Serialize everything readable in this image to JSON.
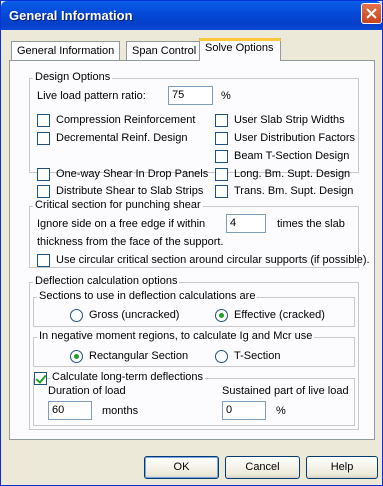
{
  "window": {
    "title": "General Information"
  },
  "tabs": [
    {
      "label": "General Information"
    },
    {
      "label": "Span Control"
    },
    {
      "label": "Solve Options"
    }
  ],
  "design_options": {
    "legend": "Design Options",
    "live_load_label": "Live load pattern ratio:",
    "live_load_value": "75",
    "live_load_unit": "%",
    "checkboxes": {
      "compression": {
        "label": "Compression Reinforcement",
        "checked": false
      },
      "decremental": {
        "label": "Decremental Reinf. Design",
        "checked": false
      },
      "user_slab_strip": {
        "label": "User Slab Strip Widths",
        "checked": false
      },
      "user_distribution": {
        "label": "User Distribution Factors",
        "checked": false
      },
      "beam_tsection": {
        "label": "Beam T-Section Design",
        "checked": false
      },
      "oneway_shear": {
        "label": "One-way Shear In Drop Panels",
        "checked": false
      },
      "distribute_shear": {
        "label": "Distribute Shear to Slab Strips",
        "checked": false
      },
      "long_bm": {
        "label": "Long. Bm. Supt. Design",
        "checked": false
      },
      "trans_bm": {
        "label": "Trans. Bm. Supt. Design",
        "checked": false
      }
    }
  },
  "punching": {
    "legend": "Critical section for punching shear",
    "ignore_label": "Ignore side on a free edge if within",
    "ignore_value": "4",
    "times_label": "times the slab",
    "thickness_label": "thickness from the face of the support.",
    "circular_label": "Use circular critical section around circular supports (if possible).",
    "circular_checked": false
  },
  "deflection": {
    "legend": "Deflection calculation options",
    "sections_legend": "Sections to use in deflection calculations are",
    "gross_label": "Gross (uncracked)",
    "effective_label": "Effective (cracked)",
    "negative_legend": "In negative moment regions, to calculate Ig and Mcr use",
    "rect_label": "Rectangular Section",
    "tsection_label": "T-Section",
    "longterm_label": "Calculate long-term deflections",
    "longterm_checked": true,
    "duration_label": "Duration of load",
    "duration_value": "60",
    "duration_unit": "months",
    "sustained_label": "Sustained part of live load",
    "sustained_value": "0",
    "sustained_unit": "%"
  },
  "buttons": {
    "ok": "OK",
    "cancel": "Cancel",
    "help": "Help"
  },
  "colors": {
    "title_bar": "#0548d8",
    "dialog_bg": "#ece9d8",
    "check_mark": "#21a121",
    "close_button": "#c8421c"
  }
}
